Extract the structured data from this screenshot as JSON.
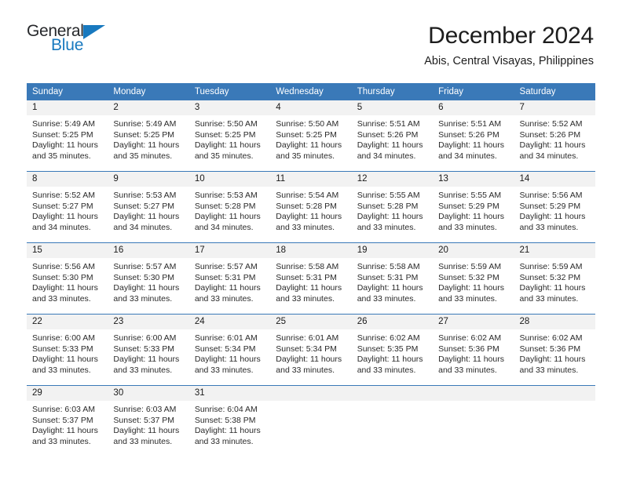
{
  "logo": {
    "name_part1": "General",
    "name_part2": "Blue",
    "triangle_color": "#1879bf"
  },
  "header": {
    "title": "December 2024",
    "subtitle": "Abis, Central Visayas, Philippines"
  },
  "theme": {
    "header_blue": "#3a79b8",
    "daynum_gray": "#f2f2f2",
    "text_dark": "#1a1a1a"
  },
  "calendar": {
    "weekdays": [
      "Sunday",
      "Monday",
      "Tuesday",
      "Wednesday",
      "Thursday",
      "Friday",
      "Saturday"
    ],
    "labels": {
      "sunrise": "Sunrise:",
      "sunset": "Sunset:",
      "daylight": "Daylight:"
    },
    "weeks": [
      [
        {
          "day": "1",
          "sunrise": "Sunrise: 5:49 AM",
          "sunset": "Sunset: 5:25 PM",
          "daylight1": "Daylight: 11 hours",
          "daylight2": "and 35 minutes."
        },
        {
          "day": "2",
          "sunrise": "Sunrise: 5:49 AM",
          "sunset": "Sunset: 5:25 PM",
          "daylight1": "Daylight: 11 hours",
          "daylight2": "and 35 minutes."
        },
        {
          "day": "3",
          "sunrise": "Sunrise: 5:50 AM",
          "sunset": "Sunset: 5:25 PM",
          "daylight1": "Daylight: 11 hours",
          "daylight2": "and 35 minutes."
        },
        {
          "day": "4",
          "sunrise": "Sunrise: 5:50 AM",
          "sunset": "Sunset: 5:25 PM",
          "daylight1": "Daylight: 11 hours",
          "daylight2": "and 35 minutes."
        },
        {
          "day": "5",
          "sunrise": "Sunrise: 5:51 AM",
          "sunset": "Sunset: 5:26 PM",
          "daylight1": "Daylight: 11 hours",
          "daylight2": "and 34 minutes."
        },
        {
          "day": "6",
          "sunrise": "Sunrise: 5:51 AM",
          "sunset": "Sunset: 5:26 PM",
          "daylight1": "Daylight: 11 hours",
          "daylight2": "and 34 minutes."
        },
        {
          "day": "7",
          "sunrise": "Sunrise: 5:52 AM",
          "sunset": "Sunset: 5:26 PM",
          "daylight1": "Daylight: 11 hours",
          "daylight2": "and 34 minutes."
        }
      ],
      [
        {
          "day": "8",
          "sunrise": "Sunrise: 5:52 AM",
          "sunset": "Sunset: 5:27 PM",
          "daylight1": "Daylight: 11 hours",
          "daylight2": "and 34 minutes."
        },
        {
          "day": "9",
          "sunrise": "Sunrise: 5:53 AM",
          "sunset": "Sunset: 5:27 PM",
          "daylight1": "Daylight: 11 hours",
          "daylight2": "and 34 minutes."
        },
        {
          "day": "10",
          "sunrise": "Sunrise: 5:53 AM",
          "sunset": "Sunset: 5:28 PM",
          "daylight1": "Daylight: 11 hours",
          "daylight2": "and 34 minutes."
        },
        {
          "day": "11",
          "sunrise": "Sunrise: 5:54 AM",
          "sunset": "Sunset: 5:28 PM",
          "daylight1": "Daylight: 11 hours",
          "daylight2": "and 33 minutes."
        },
        {
          "day": "12",
          "sunrise": "Sunrise: 5:55 AM",
          "sunset": "Sunset: 5:28 PM",
          "daylight1": "Daylight: 11 hours",
          "daylight2": "and 33 minutes."
        },
        {
          "day": "13",
          "sunrise": "Sunrise: 5:55 AM",
          "sunset": "Sunset: 5:29 PM",
          "daylight1": "Daylight: 11 hours",
          "daylight2": "and 33 minutes."
        },
        {
          "day": "14",
          "sunrise": "Sunrise: 5:56 AM",
          "sunset": "Sunset: 5:29 PM",
          "daylight1": "Daylight: 11 hours",
          "daylight2": "and 33 minutes."
        }
      ],
      [
        {
          "day": "15",
          "sunrise": "Sunrise: 5:56 AM",
          "sunset": "Sunset: 5:30 PM",
          "daylight1": "Daylight: 11 hours",
          "daylight2": "and 33 minutes."
        },
        {
          "day": "16",
          "sunrise": "Sunrise: 5:57 AM",
          "sunset": "Sunset: 5:30 PM",
          "daylight1": "Daylight: 11 hours",
          "daylight2": "and 33 minutes."
        },
        {
          "day": "17",
          "sunrise": "Sunrise: 5:57 AM",
          "sunset": "Sunset: 5:31 PM",
          "daylight1": "Daylight: 11 hours",
          "daylight2": "and 33 minutes."
        },
        {
          "day": "18",
          "sunrise": "Sunrise: 5:58 AM",
          "sunset": "Sunset: 5:31 PM",
          "daylight1": "Daylight: 11 hours",
          "daylight2": "and 33 minutes."
        },
        {
          "day": "19",
          "sunrise": "Sunrise: 5:58 AM",
          "sunset": "Sunset: 5:31 PM",
          "daylight1": "Daylight: 11 hours",
          "daylight2": "and 33 minutes."
        },
        {
          "day": "20",
          "sunrise": "Sunrise: 5:59 AM",
          "sunset": "Sunset: 5:32 PM",
          "daylight1": "Daylight: 11 hours",
          "daylight2": "and 33 minutes."
        },
        {
          "day": "21",
          "sunrise": "Sunrise: 5:59 AM",
          "sunset": "Sunset: 5:32 PM",
          "daylight1": "Daylight: 11 hours",
          "daylight2": "and 33 minutes."
        }
      ],
      [
        {
          "day": "22",
          "sunrise": "Sunrise: 6:00 AM",
          "sunset": "Sunset: 5:33 PM",
          "daylight1": "Daylight: 11 hours",
          "daylight2": "and 33 minutes."
        },
        {
          "day": "23",
          "sunrise": "Sunrise: 6:00 AM",
          "sunset": "Sunset: 5:33 PM",
          "daylight1": "Daylight: 11 hours",
          "daylight2": "and 33 minutes."
        },
        {
          "day": "24",
          "sunrise": "Sunrise: 6:01 AM",
          "sunset": "Sunset: 5:34 PM",
          "daylight1": "Daylight: 11 hours",
          "daylight2": "and 33 minutes."
        },
        {
          "day": "25",
          "sunrise": "Sunrise: 6:01 AM",
          "sunset": "Sunset: 5:34 PM",
          "daylight1": "Daylight: 11 hours",
          "daylight2": "and 33 minutes."
        },
        {
          "day": "26",
          "sunrise": "Sunrise: 6:02 AM",
          "sunset": "Sunset: 5:35 PM",
          "daylight1": "Daylight: 11 hours",
          "daylight2": "and 33 minutes."
        },
        {
          "day": "27",
          "sunrise": "Sunrise: 6:02 AM",
          "sunset": "Sunset: 5:36 PM",
          "daylight1": "Daylight: 11 hours",
          "daylight2": "and 33 minutes."
        },
        {
          "day": "28",
          "sunrise": "Sunrise: 6:02 AM",
          "sunset": "Sunset: 5:36 PM",
          "daylight1": "Daylight: 11 hours",
          "daylight2": "and 33 minutes."
        }
      ],
      [
        {
          "day": "29",
          "sunrise": "Sunrise: 6:03 AM",
          "sunset": "Sunset: 5:37 PM",
          "daylight1": "Daylight: 11 hours",
          "daylight2": "and 33 minutes."
        },
        {
          "day": "30",
          "sunrise": "Sunrise: 6:03 AM",
          "sunset": "Sunset: 5:37 PM",
          "daylight1": "Daylight: 11 hours",
          "daylight2": "and 33 minutes."
        },
        {
          "day": "31",
          "sunrise": "Sunrise: 6:04 AM",
          "sunset": "Sunset: 5:38 PM",
          "daylight1": "Daylight: 11 hours",
          "daylight2": "and 33 minutes."
        },
        {
          "day": "",
          "sunrise": "",
          "sunset": "",
          "daylight1": "",
          "daylight2": ""
        },
        {
          "day": "",
          "sunrise": "",
          "sunset": "",
          "daylight1": "",
          "daylight2": ""
        },
        {
          "day": "",
          "sunrise": "",
          "sunset": "",
          "daylight1": "",
          "daylight2": ""
        },
        {
          "day": "",
          "sunrise": "",
          "sunset": "",
          "daylight1": "",
          "daylight2": ""
        }
      ]
    ]
  }
}
